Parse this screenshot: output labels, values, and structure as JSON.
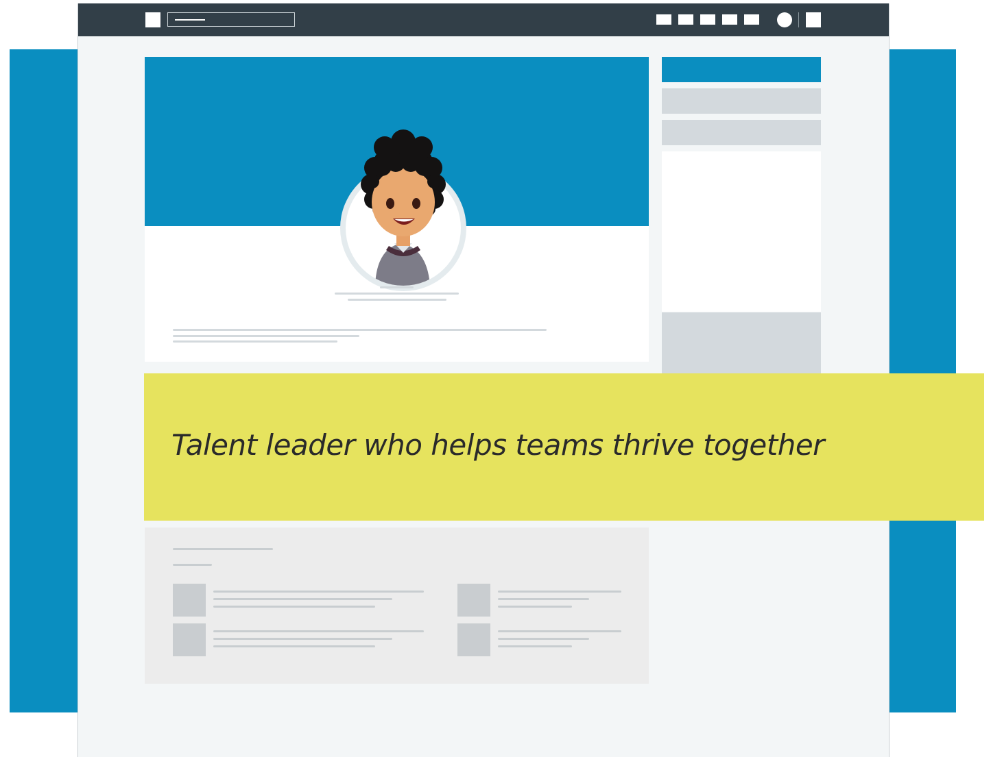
{
  "colors": {
    "accent_blue": "#0a8ec0",
    "topbar": "#323f48",
    "page_bg": "#f3f6f7",
    "highlight_yellow": "#e6e35e",
    "panel_gray": "#d3d9dd",
    "card_gray": "#ececec"
  },
  "topbar": {
    "icons": [
      "logo-square-icon",
      "search-icon",
      "nav-icon",
      "nav-icon",
      "nav-icon",
      "nav-icon",
      "nav-icon",
      "avatar-icon",
      "menu-square-icon"
    ]
  },
  "profile": {
    "avatar": "person-curly-hair-avatar"
  },
  "banner": {
    "headline": "Talent leader who helps teams thrive together"
  }
}
